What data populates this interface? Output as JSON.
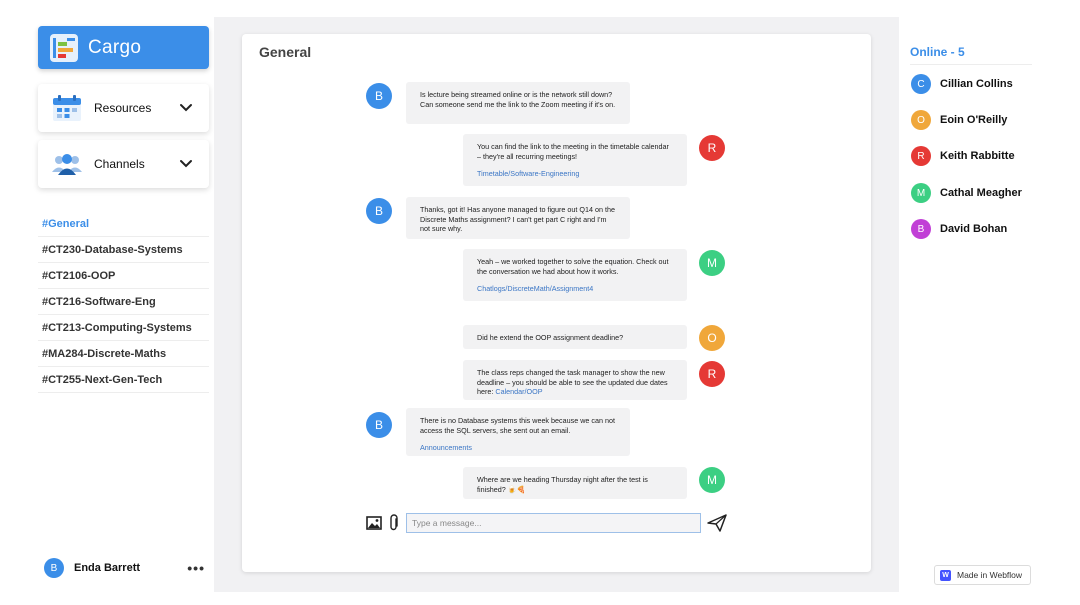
{
  "app": {
    "name": "Cargo"
  },
  "sidebar": {
    "dropdowns": [
      {
        "label": "Resources",
        "icon": "calendar-icon"
      },
      {
        "label": "Channels",
        "icon": "people-icon"
      }
    ],
    "channels": [
      "#General",
      "#CT230-Database-Systems",
      "#CT2106-OOP",
      "#CT216-Software-Eng",
      "#CT213-Computing-Systems",
      "#MA284-Discrete-Maths",
      "#CT255-Next-Gen-Tech"
    ],
    "active_channel": "#General",
    "current_user": {
      "initial": "B",
      "name": "Enda Barrett",
      "more": "•••"
    }
  },
  "chat": {
    "title": "General",
    "messages": [
      {
        "initial": "B",
        "color": "#3b8ee8",
        "side": "left",
        "text": "Is lecture being streamed online or is the network still down? Can someone send me the link to the Zoom meeting if it's on."
      },
      {
        "initial": "R",
        "color": "#e53935",
        "side": "right",
        "text": "You can find the link to the meeting in the timetable calendar – they're all recurring meetings!",
        "link": "Timetable/Software-Engineering"
      },
      {
        "initial": "B",
        "color": "#3b8ee8",
        "side": "left",
        "text": "Thanks, got it! Has anyone managed to figure out Q14 on the Discrete Maths assignment? I can't get part C right and I'm not sure why."
      },
      {
        "initial": "M",
        "color": "#3ccf83",
        "side": "right",
        "text": "Yeah – we worked together to solve the equation. Check out the conversation we had about how it works.",
        "link": "Chatlogs/DiscreteMath/Assignment4"
      },
      {
        "initial": "O",
        "color": "#f0a73a",
        "side": "right",
        "text": "Did he extend the OOP assignment deadline?"
      },
      {
        "initial": "R",
        "color": "#e53935",
        "side": "right",
        "text": "The class reps changed the task manager to show the new deadline – you should be able to see the updated due dates here:",
        "inline_link": "Calendar/OOP"
      },
      {
        "initial": "B",
        "color": "#3b8ee8",
        "side": "left",
        "text": "There is no Database systems this week because we can not access the SQL servers, she sent out an email.",
        "link": "Announcements"
      },
      {
        "initial": "M",
        "color": "#3ccf83",
        "side": "right",
        "text": "Where are we heading Thursday night after the test is finished? 🍺🍕"
      }
    ],
    "composer": {
      "placeholder": "Type a message..."
    }
  },
  "online": {
    "title": "Online - 5",
    "users": [
      {
        "initial": "C",
        "name": "Cillian Collins",
        "color": "#3b8ee8"
      },
      {
        "initial": "O",
        "name": "Eoin O'Reilly",
        "color": "#f0a73a"
      },
      {
        "initial": "R",
        "name": "Keith Rabbitte",
        "color": "#e53935"
      },
      {
        "initial": "M",
        "name": "Cathal Meagher",
        "color": "#3ccf83"
      },
      {
        "initial": "B",
        "name": "David Bohan",
        "color": "#c13fd6"
      }
    ]
  },
  "badge": {
    "logo": "W",
    "label": "Made in Webflow"
  },
  "colors": {
    "accent": "#3b8ee8",
    "background": "#f1f1f3"
  }
}
